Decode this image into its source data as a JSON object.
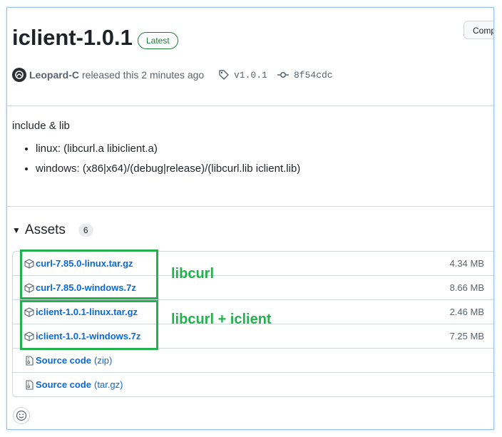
{
  "release": {
    "title": "iclient-1.0.1",
    "badge": "Latest",
    "compare_label": "Comp",
    "author": "Leopard-C",
    "released_text": "released this 2 minutes ago",
    "tag": "v1.0.1",
    "commit": "8f54cdc"
  },
  "notes": {
    "intro": "include & lib",
    "items": [
      "linux: (libcurl.a libiclient.a)",
      "windows: (x86|x64)/(debug|release)/(libcurl.lib iclient.lib)"
    ]
  },
  "assets": {
    "title": "Assets",
    "count": "6",
    "files": [
      {
        "name": "curl-7.85.0-linux.tar.gz",
        "size": "4.34 MB"
      },
      {
        "name": "curl-7.85.0-windows.7z",
        "size": "8.66 MB"
      },
      {
        "name": "iclient-1.0.1-linux.tar.gz",
        "size": "2.46 MB"
      },
      {
        "name": "iclient-1.0.1-windows.7z",
        "size": "7.25 MB"
      }
    ],
    "source": [
      {
        "label": "Source code",
        "ext": "(zip)"
      },
      {
        "label": "Source code",
        "ext": "(tar.gz)"
      }
    ]
  },
  "annotations": {
    "group1": "libcurl",
    "group2": "libcurl + iclient",
    "color": "#22b14c"
  },
  "colors": {
    "link": "#0969da",
    "badge_green": "#1a7f37",
    "muted": "#59636e"
  }
}
